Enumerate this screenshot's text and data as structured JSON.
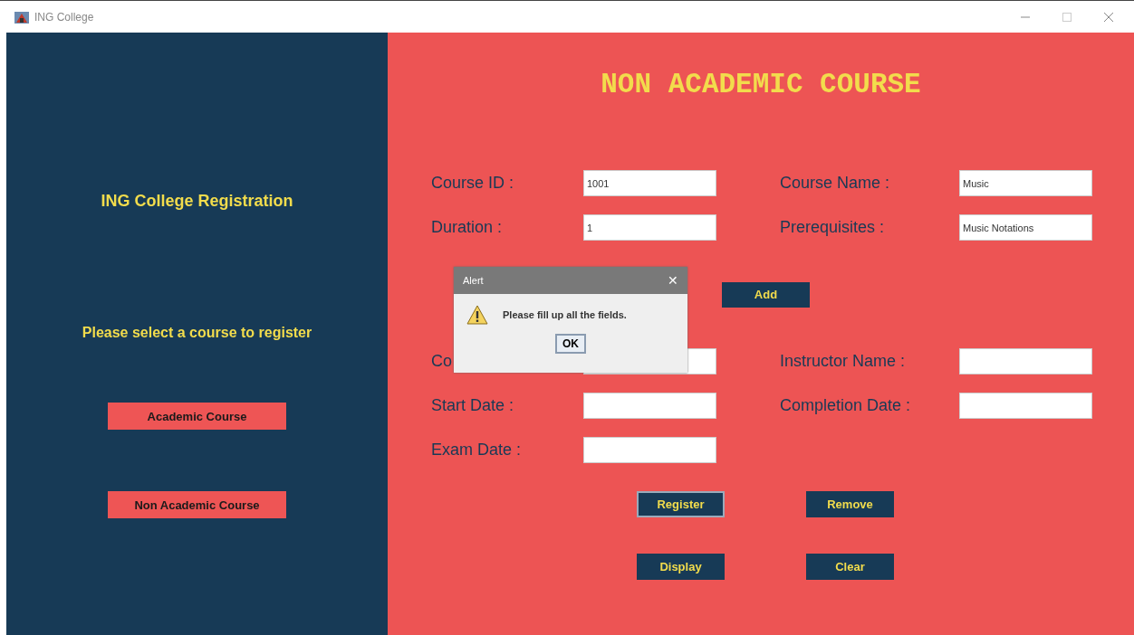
{
  "window": {
    "title": "ING College"
  },
  "sidebar": {
    "heading": "ING College Registration",
    "prompt": "Please select a course to register",
    "buttons": [
      {
        "label": "Academic Course"
      },
      {
        "label": "Non Academic Course"
      }
    ]
  },
  "form": {
    "title": "NON ACADEMIC COURSE",
    "rows": [
      {
        "fields": [
          {
            "label": "Course ID :",
            "value": "1001"
          },
          {
            "label": "Course Name :",
            "value": "Music"
          }
        ]
      },
      {
        "fields": [
          {
            "label": "Duration :",
            "value": "1"
          },
          {
            "label": "Prerequisites :",
            "value": "Music Notations"
          }
        ]
      },
      {
        "fields": [
          {
            "label": "Co"
          },
          {
            "label": "Instructor Name :"
          }
        ]
      },
      {
        "fields": [
          {
            "label": "Start Date :"
          },
          {
            "label": "Completion Date :"
          }
        ]
      },
      {
        "fields": [
          {
            "label": "Exam Date :"
          }
        ]
      }
    ],
    "add_button": "Add",
    "buttons": [
      {
        "label": "Register",
        "focused": true
      },
      {
        "label": "Remove",
        "focused": false
      },
      {
        "label": "Display",
        "focused": false
      },
      {
        "label": "Clear",
        "focused": false
      }
    ]
  },
  "dialog": {
    "title": "Alert",
    "close": "✕",
    "message": "Please fill up all the fields.",
    "ok": "OK"
  }
}
